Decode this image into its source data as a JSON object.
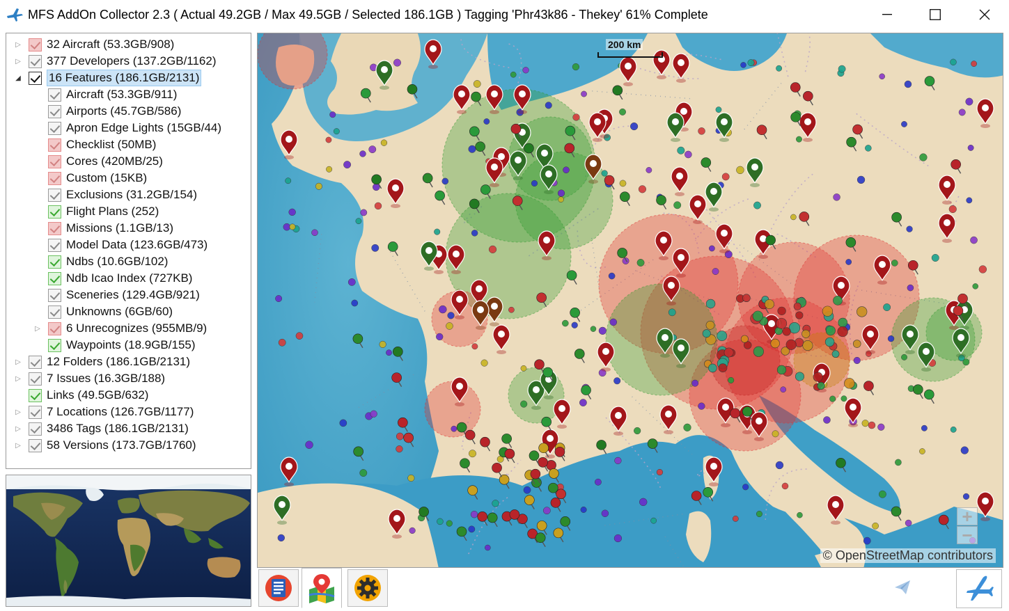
{
  "window": {
    "title": "MFS AddOn Collector 2.3 ( Actual 49.2GB / Max 49.5GB / Selected 186.1GB ) Tagging 'Phr43k86 - Thekey' 61% Complete",
    "minimize": "—",
    "maximize": "☐",
    "close": "✕",
    "icon": "plane-icon"
  },
  "tree": [
    {
      "label": "32 Aircraft (53.3GB/908)",
      "level": 0,
      "expander": "collapsed",
      "check": "red"
    },
    {
      "label": "377 Developers (137.2GB/1162)",
      "level": 0,
      "expander": "collapsed",
      "check": "grey"
    },
    {
      "label": "16 Features (186.1GB/2131)",
      "level": 0,
      "expander": "expanded",
      "check": "black",
      "selected": true
    },
    {
      "label": "Aircraft (53.3GB/911)",
      "level": 1,
      "expander": "none",
      "check": "grey"
    },
    {
      "label": "Airports (45.7GB/586)",
      "level": 1,
      "expander": "none",
      "check": "grey"
    },
    {
      "label": "Apron Edge Lights (15GB/44)",
      "level": 1,
      "expander": "none",
      "check": "grey"
    },
    {
      "label": "Checklist (50MB)",
      "level": 1,
      "expander": "none",
      "check": "red"
    },
    {
      "label": "Cores (420MB/25)",
      "level": 1,
      "expander": "none",
      "check": "red"
    },
    {
      "label": "Custom (15KB)",
      "level": 1,
      "expander": "none",
      "check": "red"
    },
    {
      "label": "Exclusions (31.2GB/154)",
      "level": 1,
      "expander": "none",
      "check": "grey"
    },
    {
      "label": "Flight Plans (252)",
      "level": 1,
      "expander": "none",
      "check": "green"
    },
    {
      "label": "Missions (1.1GB/13)",
      "level": 1,
      "expander": "none",
      "check": "red"
    },
    {
      "label": "Model Data (123.6GB/473)",
      "level": 1,
      "expander": "none",
      "check": "grey"
    },
    {
      "label": "Ndbs (10.6GB/102)",
      "level": 1,
      "expander": "none",
      "check": "green"
    },
    {
      "label": "Ndb Icao Index (727KB)",
      "level": 1,
      "expander": "none",
      "check": "green"
    },
    {
      "label": "Sceneries (129.4GB/921)",
      "level": 1,
      "expander": "none",
      "check": "grey"
    },
    {
      "label": "Unknowns (6GB/60)",
      "level": 1,
      "expander": "none",
      "check": "grey"
    },
    {
      "label": "6 Unrecognizes (955MB/9)",
      "level": 1,
      "expander": "collapsed",
      "check": "red"
    },
    {
      "label": "Waypoints (18.9GB/155)",
      "level": 1,
      "expander": "none",
      "check": "green"
    },
    {
      "label": "12 Folders (186.1GB/2131)",
      "level": 0,
      "expander": "collapsed",
      "check": "grey"
    },
    {
      "label": "7 Issues (16.3GB/188)",
      "level": 0,
      "expander": "collapsed",
      "check": "grey"
    },
    {
      "label": "Links (49.5GB/632)",
      "level": 0,
      "expander": "none",
      "check": "green"
    },
    {
      "label": "7 Locations (126.7GB/1177)",
      "level": 0,
      "expander": "collapsed",
      "check": "grey"
    },
    {
      "label": "3486 Tags (186.1GB/2131)",
      "level": 0,
      "expander": "collapsed",
      "check": "grey"
    },
    {
      "label": "58 Versions (173.7GB/1760)",
      "level": 0,
      "expander": "collapsed",
      "check": "grey"
    }
  ],
  "map": {
    "scale_label": "200 km",
    "attribution": "© OpenStreetMap contributors",
    "zoom_in": "+",
    "zoom_out": "−",
    "colors": {
      "sea": "#4fa7c9",
      "land": "#ecdcbd",
      "red_marker": "#b01e1e",
      "green_marker": "#2f7a2a"
    }
  },
  "tabs": [
    {
      "name": "document-list-icon",
      "active": false
    },
    {
      "name": "map-icon",
      "active": true
    },
    {
      "name": "gear-icon",
      "active": false
    }
  ],
  "bottom_right": {
    "send_icon": "paper-plane-icon",
    "plane_button_icon": "airplane-icon"
  }
}
